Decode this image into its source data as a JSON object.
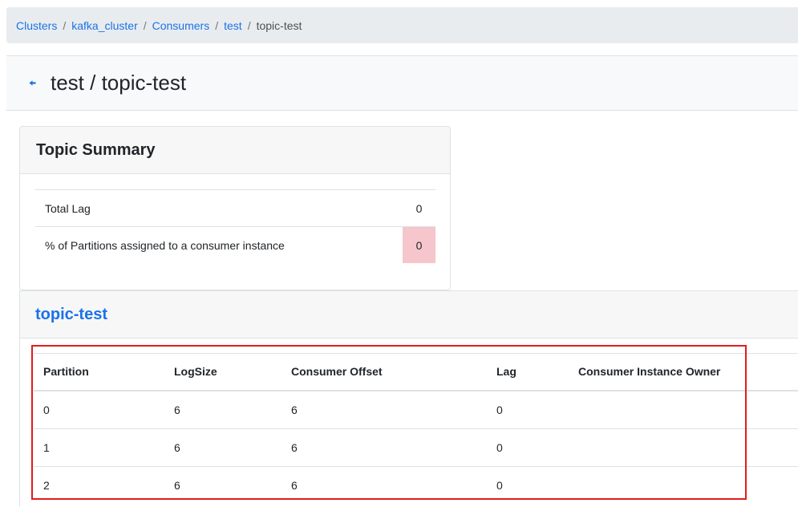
{
  "breadcrumb": {
    "items": [
      "Clusters",
      "kafka_cluster",
      "Consumers",
      "test"
    ],
    "separator": "/",
    "current": "topic-test"
  },
  "header": {
    "back_icon": "arrow-left-icon",
    "title": "test / topic-test"
  },
  "summary": {
    "title": "Topic Summary",
    "rows": [
      {
        "label": "Total Lag",
        "value": "0"
      },
      {
        "label": "% of Partitions assigned to a consumer instance",
        "value": "0"
      }
    ]
  },
  "topic": {
    "name": "topic-test",
    "columns": [
      "Partition",
      "LogSize",
      "Consumer Offset",
      "Lag",
      "Consumer Instance Owner"
    ],
    "rows": [
      [
        "0",
        "6",
        "6",
        "0",
        ""
      ],
      [
        "1",
        "6",
        "6",
        "0",
        ""
      ],
      [
        "2",
        "6",
        "6",
        "0",
        ""
      ]
    ]
  },
  "colors": {
    "link": "#1a73e8",
    "danger_cell": "#f5c6cb",
    "highlight": "#e11d1d"
  }
}
